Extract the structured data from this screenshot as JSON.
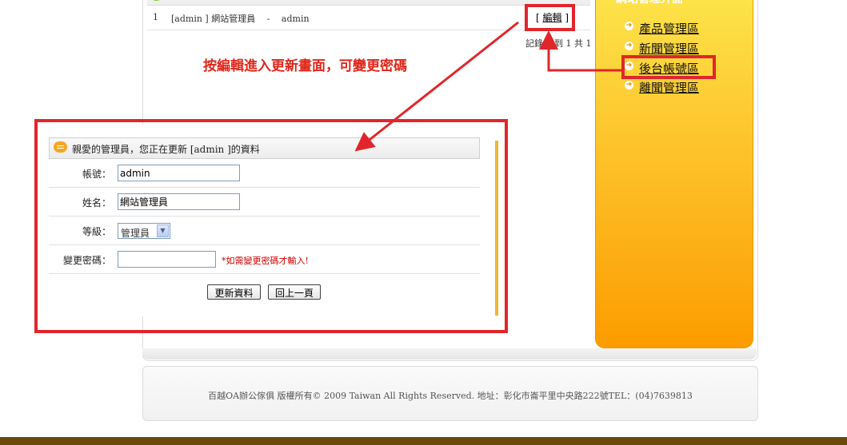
{
  "list": {
    "row": {
      "number": "1",
      "account": "[admin ] 網站管理員 　- 　admin",
      "edit_label": "編輯"
    },
    "record_info": "記錄 1 到 1 共 1"
  },
  "annotation": "按編輯進入更新畫面，可變更密碼",
  "sidebar": {
    "title": "網站管理介面",
    "items": [
      {
        "label": "產品管理區"
      },
      {
        "label": "新聞管理區"
      },
      {
        "label": "後台帳號區"
      },
      {
        "label": "離聞管理區"
      }
    ]
  },
  "form": {
    "title": "親愛的管理員，您正在更新 [admin ]的資料",
    "account_label": "帳號：",
    "account_value": "admin",
    "name_label": "姓名：",
    "name_value": "網站管理員",
    "level_label": "等級：",
    "level_value": "管理員",
    "password_label": "變更密碼：",
    "password_value": "",
    "password_hint": "*如需變更密碼才輸入!",
    "update_button": "更新資料",
    "back_button": "回上一頁"
  },
  "footer": "百越OA辦公傢俱 版權所有© 2009 Taiwan All Rights Reserved. 地址：彰化市崙平里中央路222號TEL：(04)7639813",
  "colors": {
    "annotation": "#e0261a",
    "sidebar_top": "#fde44a",
    "sidebar_bottom": "#fc9c00",
    "bottom_bar": "#6b4a0e"
  }
}
